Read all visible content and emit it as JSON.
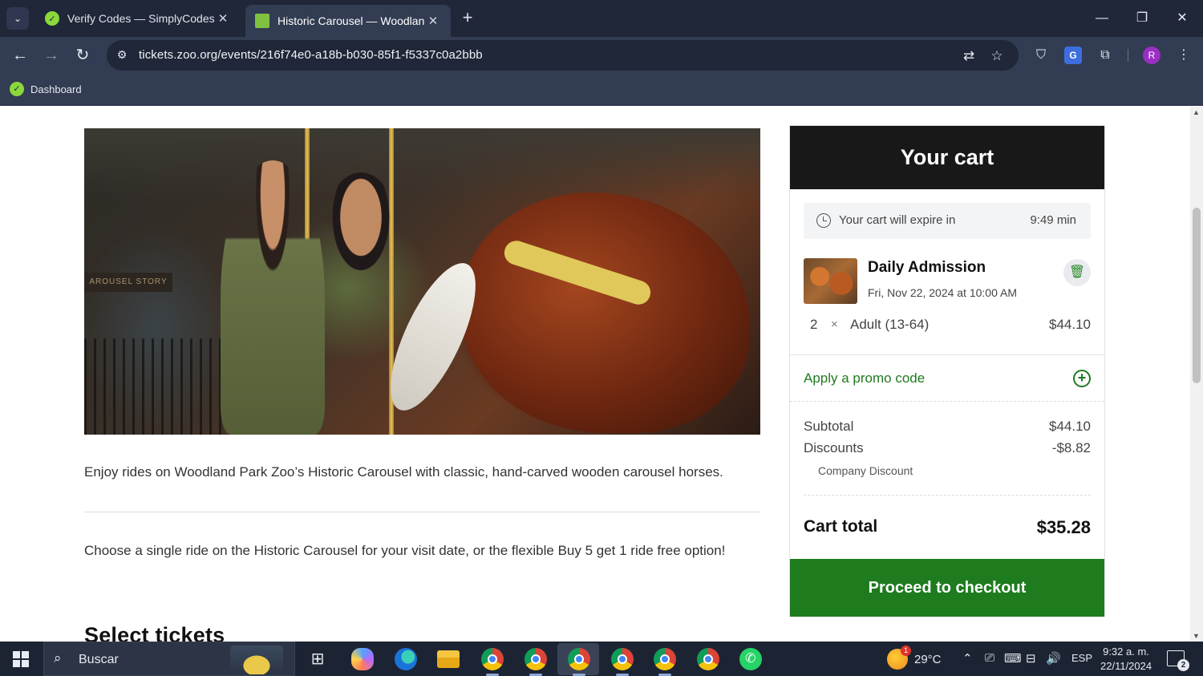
{
  "browser": {
    "tabs": [
      {
        "title": "Verify Codes — SimplyCodes",
        "favicon": "simplycodes-icon"
      },
      {
        "title": "Historic Carousel — Woodland",
        "favicon": "zoo-icon",
        "active": true
      }
    ],
    "address": "tickets.zoo.org/events/216f74e0-a18b-b030-85f1-f5337c0a2bbb",
    "bookmarks": [
      {
        "label": "Dashboard"
      }
    ],
    "profile_initial": "R"
  },
  "page": {
    "hero_sign_text": "AROUSEL STORY",
    "description": "Enjoy rides on Woodland Park Zoo’s Historic Carousel with classic, hand-carved wooden carousel horses.",
    "description2": "Choose a single ride on the Historic Carousel for your visit date, or the flexible Buy 5 get 1 ride free option!",
    "section_title": "Select tickets"
  },
  "cart": {
    "title": "Your cart",
    "expire_label": "Your cart will expire in",
    "expire_value": "9:49 min",
    "item": {
      "title": "Daily Admission",
      "date": "Fri, Nov 22, 2024 at 10:00 AM",
      "qty": "2",
      "mult": "×",
      "ticket": "Adult (13-64)",
      "price": "$44.10"
    },
    "promo_label": "Apply a promo code",
    "subtotal_label": "Subtotal",
    "subtotal_value": "$44.10",
    "discounts_label": "Discounts",
    "discounts_value": "-$8.82",
    "discount_name": "Company Discount",
    "total_label": "Cart total",
    "total_value": "$35.28",
    "checkout_label": "Proceed to checkout",
    "accent_color": "#1e7b1e"
  },
  "taskbar": {
    "search_placeholder": "Buscar",
    "weather": "29°C",
    "language": "ESP",
    "time": "9:32 a. m.",
    "date": "22/11/2024",
    "notifications": "2"
  }
}
